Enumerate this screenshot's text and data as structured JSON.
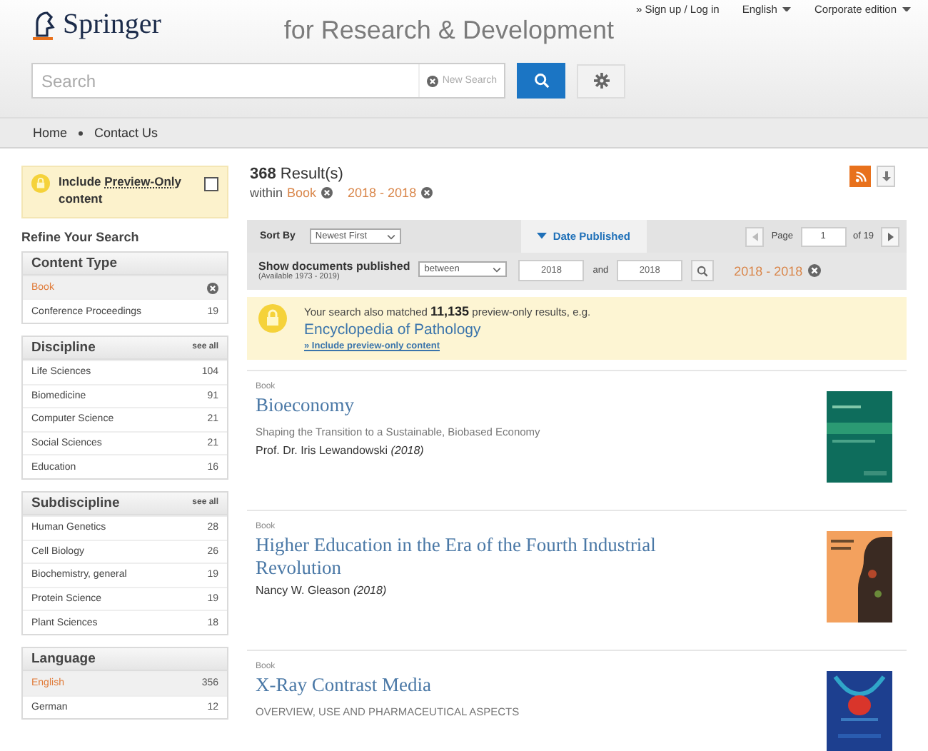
{
  "header": {
    "logo": "Springer",
    "tagline": "for Research & Development",
    "top_links": [
      {
        "label": "» Sign up / Log in",
        "kind": "link"
      },
      {
        "label": "English",
        "kind": "dropdown"
      },
      {
        "label": "Corporate edition",
        "kind": "dropdown"
      }
    ],
    "search": {
      "placeholder": "Search",
      "new_search": "New Search"
    }
  },
  "breadcrumb": [
    "Home",
    "Contact Us"
  ],
  "sidebar": {
    "preview_toggle": {
      "label": "Include **Preview-Only** content",
      "checked": false
    },
    "refine_title": "Refine Your Search",
    "facets": [
      {
        "title": "Content Type",
        "items": [
          {
            "label": "Book",
            "selected": true
          },
          {
            "label": "Conference Proceedings",
            "count": "19",
            "selected": false
          }
        ]
      },
      {
        "title": "Discipline",
        "see_all": "see all",
        "items": [
          {
            "label": "Life Sciences",
            "count": "104",
            "selected": false
          },
          {
            "label": "Biomedicine",
            "count": "91",
            "selected": false
          },
          {
            "label": "Computer Science",
            "count": "21",
            "selected": false
          },
          {
            "label": "Social Sciences",
            "count": "21",
            "selected": false
          },
          {
            "label": "Education",
            "count": "16",
            "selected": false
          }
        ]
      },
      {
        "title": "Subdiscipline",
        "see_all": "see all",
        "items": [
          {
            "label": "Human Genetics",
            "count": "28",
            "selected": false
          },
          {
            "label": "Cell Biology",
            "count": "26",
            "selected": false
          },
          {
            "label": "Biochemistry, general",
            "count": "19",
            "selected": false
          },
          {
            "label": "Protein Science",
            "count": "19",
            "selected": false
          },
          {
            "label": "Plant Sciences",
            "count": "18",
            "selected": false
          }
        ]
      },
      {
        "title": "Language",
        "items": [
          {
            "label": "English",
            "count": "356",
            "selected": true
          },
          {
            "label": "German",
            "count": "12",
            "selected": false
          }
        ]
      }
    ]
  },
  "results": {
    "count": "368",
    "count_label": "Result(s)",
    "within": "within",
    "filters": [
      "Book",
      "2018 - 2018"
    ],
    "sort": {
      "label": "Sort By",
      "value": "Newest First"
    },
    "date_tab": "Date Published",
    "pager": {
      "label": "Page",
      "value": "1",
      "of": "of 19"
    },
    "date_filter": {
      "label": "Show documents published",
      "mode": "between",
      "from": "2018",
      "and": "and",
      "to": "2018",
      "active": "2018 - 2018",
      "available": "(Available 1973 - 2019)"
    },
    "notice": {
      "text": "Your search also matched **11,135** preview-only results, e.g.",
      "example": "Encyclopedia of Pathology",
      "link": "» Include preview-only content"
    },
    "items": [
      {
        "type": "Book",
        "title": "Bioeconomy",
        "subtitle": "Shaping the Transition to a Sustainable, Biobased Economy",
        "author": "Prof. Dr. Iris Lewandowski",
        "year": "(2018)"
      },
      {
        "type": "Book",
        "title": "Higher Education in the Era of the Fourth Industrial Revolution",
        "author": "Nancy W. Gleason",
        "year": "(2018)"
      },
      {
        "type": "Book",
        "title": "X-Ray Contrast Media",
        "subtitle": "OVERVIEW, USE AND PHARMACEUTICAL ASPECTS"
      }
    ]
  }
}
